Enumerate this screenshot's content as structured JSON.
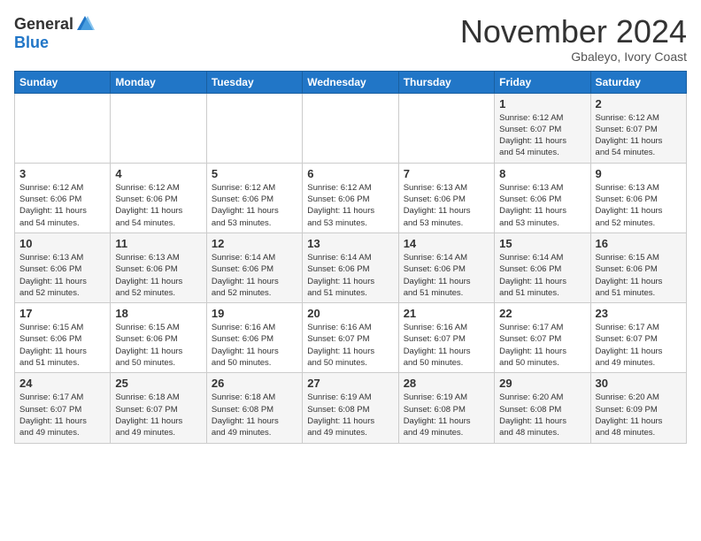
{
  "logo": {
    "general": "General",
    "blue": "Blue"
  },
  "header": {
    "title": "November 2024",
    "location": "Gbaleyo, Ivory Coast"
  },
  "weekdays": [
    "Sunday",
    "Monday",
    "Tuesday",
    "Wednesday",
    "Thursday",
    "Friday",
    "Saturday"
  ],
  "weeks": [
    [
      {
        "day": "",
        "info": ""
      },
      {
        "day": "",
        "info": ""
      },
      {
        "day": "",
        "info": ""
      },
      {
        "day": "",
        "info": ""
      },
      {
        "day": "",
        "info": ""
      },
      {
        "day": "1",
        "info": "Sunrise: 6:12 AM\nSunset: 6:07 PM\nDaylight: 11 hours\nand 54 minutes."
      },
      {
        "day": "2",
        "info": "Sunrise: 6:12 AM\nSunset: 6:07 PM\nDaylight: 11 hours\nand 54 minutes."
      }
    ],
    [
      {
        "day": "3",
        "info": "Sunrise: 6:12 AM\nSunset: 6:06 PM\nDaylight: 11 hours\nand 54 minutes."
      },
      {
        "day": "4",
        "info": "Sunrise: 6:12 AM\nSunset: 6:06 PM\nDaylight: 11 hours\nand 54 minutes."
      },
      {
        "day": "5",
        "info": "Sunrise: 6:12 AM\nSunset: 6:06 PM\nDaylight: 11 hours\nand 53 minutes."
      },
      {
        "day": "6",
        "info": "Sunrise: 6:12 AM\nSunset: 6:06 PM\nDaylight: 11 hours\nand 53 minutes."
      },
      {
        "day": "7",
        "info": "Sunrise: 6:13 AM\nSunset: 6:06 PM\nDaylight: 11 hours\nand 53 minutes."
      },
      {
        "day": "8",
        "info": "Sunrise: 6:13 AM\nSunset: 6:06 PM\nDaylight: 11 hours\nand 53 minutes."
      },
      {
        "day": "9",
        "info": "Sunrise: 6:13 AM\nSunset: 6:06 PM\nDaylight: 11 hours\nand 52 minutes."
      }
    ],
    [
      {
        "day": "10",
        "info": "Sunrise: 6:13 AM\nSunset: 6:06 PM\nDaylight: 11 hours\nand 52 minutes."
      },
      {
        "day": "11",
        "info": "Sunrise: 6:13 AM\nSunset: 6:06 PM\nDaylight: 11 hours\nand 52 minutes."
      },
      {
        "day": "12",
        "info": "Sunrise: 6:14 AM\nSunset: 6:06 PM\nDaylight: 11 hours\nand 52 minutes."
      },
      {
        "day": "13",
        "info": "Sunrise: 6:14 AM\nSunset: 6:06 PM\nDaylight: 11 hours\nand 51 minutes."
      },
      {
        "day": "14",
        "info": "Sunrise: 6:14 AM\nSunset: 6:06 PM\nDaylight: 11 hours\nand 51 minutes."
      },
      {
        "day": "15",
        "info": "Sunrise: 6:14 AM\nSunset: 6:06 PM\nDaylight: 11 hours\nand 51 minutes."
      },
      {
        "day": "16",
        "info": "Sunrise: 6:15 AM\nSunset: 6:06 PM\nDaylight: 11 hours\nand 51 minutes."
      }
    ],
    [
      {
        "day": "17",
        "info": "Sunrise: 6:15 AM\nSunset: 6:06 PM\nDaylight: 11 hours\nand 51 minutes."
      },
      {
        "day": "18",
        "info": "Sunrise: 6:15 AM\nSunset: 6:06 PM\nDaylight: 11 hours\nand 50 minutes."
      },
      {
        "day": "19",
        "info": "Sunrise: 6:16 AM\nSunset: 6:06 PM\nDaylight: 11 hours\nand 50 minutes."
      },
      {
        "day": "20",
        "info": "Sunrise: 6:16 AM\nSunset: 6:07 PM\nDaylight: 11 hours\nand 50 minutes."
      },
      {
        "day": "21",
        "info": "Sunrise: 6:16 AM\nSunset: 6:07 PM\nDaylight: 11 hours\nand 50 minutes."
      },
      {
        "day": "22",
        "info": "Sunrise: 6:17 AM\nSunset: 6:07 PM\nDaylight: 11 hours\nand 50 minutes."
      },
      {
        "day": "23",
        "info": "Sunrise: 6:17 AM\nSunset: 6:07 PM\nDaylight: 11 hours\nand 49 minutes."
      }
    ],
    [
      {
        "day": "24",
        "info": "Sunrise: 6:17 AM\nSunset: 6:07 PM\nDaylight: 11 hours\nand 49 minutes."
      },
      {
        "day": "25",
        "info": "Sunrise: 6:18 AM\nSunset: 6:07 PM\nDaylight: 11 hours\nand 49 minutes."
      },
      {
        "day": "26",
        "info": "Sunrise: 6:18 AM\nSunset: 6:08 PM\nDaylight: 11 hours\nand 49 minutes."
      },
      {
        "day": "27",
        "info": "Sunrise: 6:19 AM\nSunset: 6:08 PM\nDaylight: 11 hours\nand 49 minutes."
      },
      {
        "day": "28",
        "info": "Sunrise: 6:19 AM\nSunset: 6:08 PM\nDaylight: 11 hours\nand 49 minutes."
      },
      {
        "day": "29",
        "info": "Sunrise: 6:20 AM\nSunset: 6:08 PM\nDaylight: 11 hours\nand 48 minutes."
      },
      {
        "day": "30",
        "info": "Sunrise: 6:20 AM\nSunset: 6:09 PM\nDaylight: 11 hours\nand 48 minutes."
      }
    ]
  ]
}
